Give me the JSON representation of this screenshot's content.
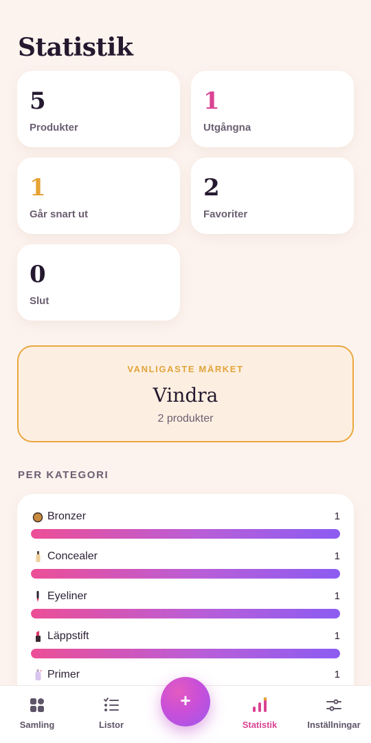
{
  "page": {
    "title": "Statistik"
  },
  "stats": [
    {
      "value": "5",
      "label": "Produkter",
      "color": "#24192f"
    },
    {
      "value": "1",
      "label": "Utgångna",
      "color": "#d94392"
    },
    {
      "value": "1",
      "label": "Går snart ut",
      "color": "#e6a234"
    },
    {
      "value": "2",
      "label": "Favoriter",
      "color": "#24192f"
    },
    {
      "value": "0",
      "label": "Slut",
      "color": "#24192f"
    }
  ],
  "top_brand": {
    "kicker": "VANLIGASTE MÄRKET",
    "name": "Vindra",
    "count": "2 produkter",
    "accent": "#e9a63c"
  },
  "categories": {
    "heading": "PER KATEGORI",
    "items": [
      {
        "name": "Bronzer",
        "count": "1",
        "fill": 1.0,
        "icon": "bronzer-icon"
      },
      {
        "name": "Concealer",
        "count": "1",
        "fill": 1.0,
        "icon": "concealer-icon"
      },
      {
        "name": "Eyeliner",
        "count": "1",
        "fill": 1.0,
        "icon": "eyeliner-icon"
      },
      {
        "name": "Läppstift",
        "count": "1",
        "fill": 1.0,
        "icon": "lipstick-icon"
      },
      {
        "name": "Primer",
        "count": "1",
        "fill": 1.0,
        "icon": "primer-icon"
      }
    ]
  },
  "nav": {
    "items": [
      {
        "label": "Samling",
        "icon": "grid-icon",
        "active": false
      },
      {
        "label": "Listor",
        "icon": "list-icon",
        "active": false
      },
      {
        "label": "Statistik",
        "icon": "bar-chart-icon",
        "active": true
      },
      {
        "label": "Inställningar",
        "icon": "sliders-icon",
        "active": false
      }
    ],
    "fab_icon": "plus-icon",
    "fab_label": "+",
    "active_color": "#d94392"
  }
}
